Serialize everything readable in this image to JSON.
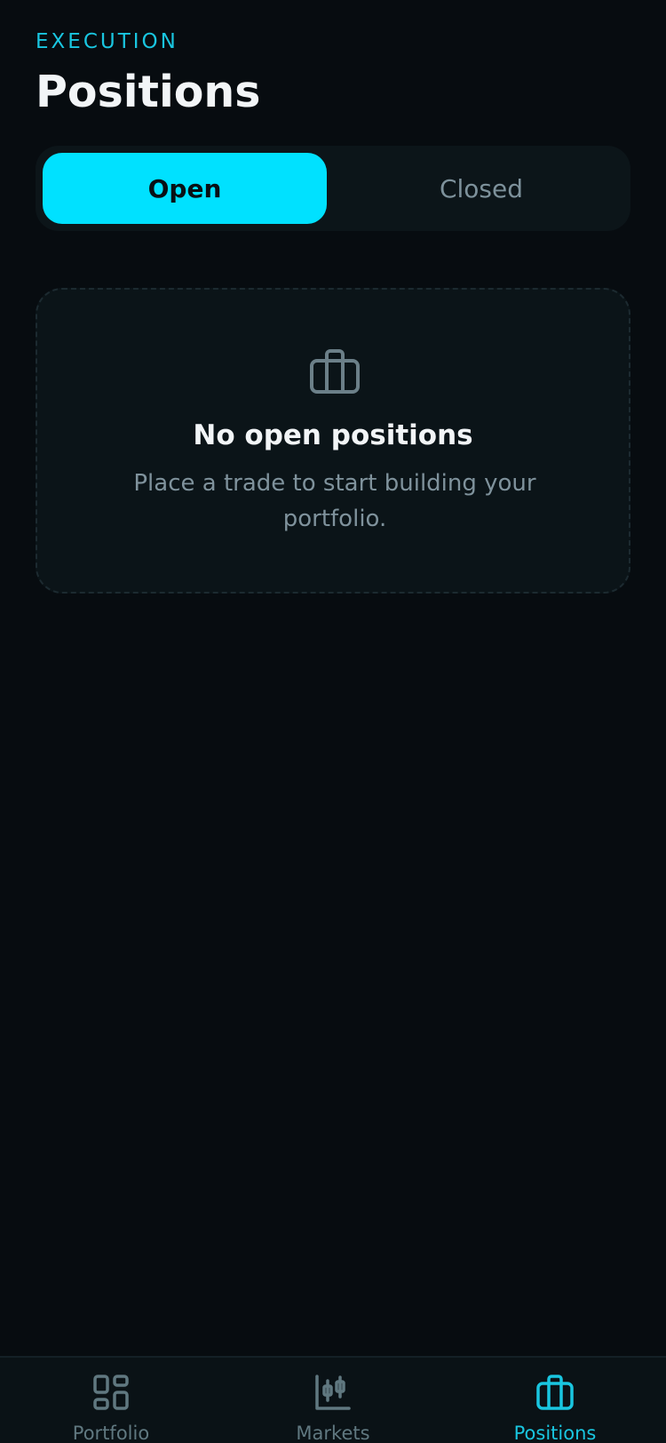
{
  "header": {
    "eyebrow": "EXECUTION",
    "title": "Positions"
  },
  "segmented": {
    "options": [
      {
        "label": "Open",
        "selected": true
      },
      {
        "label": "Closed",
        "selected": false
      }
    ]
  },
  "empty_state": {
    "icon": "briefcase-icon",
    "title": "No open positions",
    "subtitle": "Place a trade to start building your portfolio."
  },
  "tabbar": {
    "items": [
      {
        "label": "Portfolio",
        "icon": "grid-icon",
        "active": false
      },
      {
        "label": "Markets",
        "icon": "candlestick-chart-icon",
        "active": false
      },
      {
        "label": "Positions",
        "icon": "briefcase-icon",
        "active": true
      }
    ]
  },
  "colors": {
    "background": "#070c10",
    "accent": "#00e1ff",
    "muted_text": "#7f929c"
  }
}
